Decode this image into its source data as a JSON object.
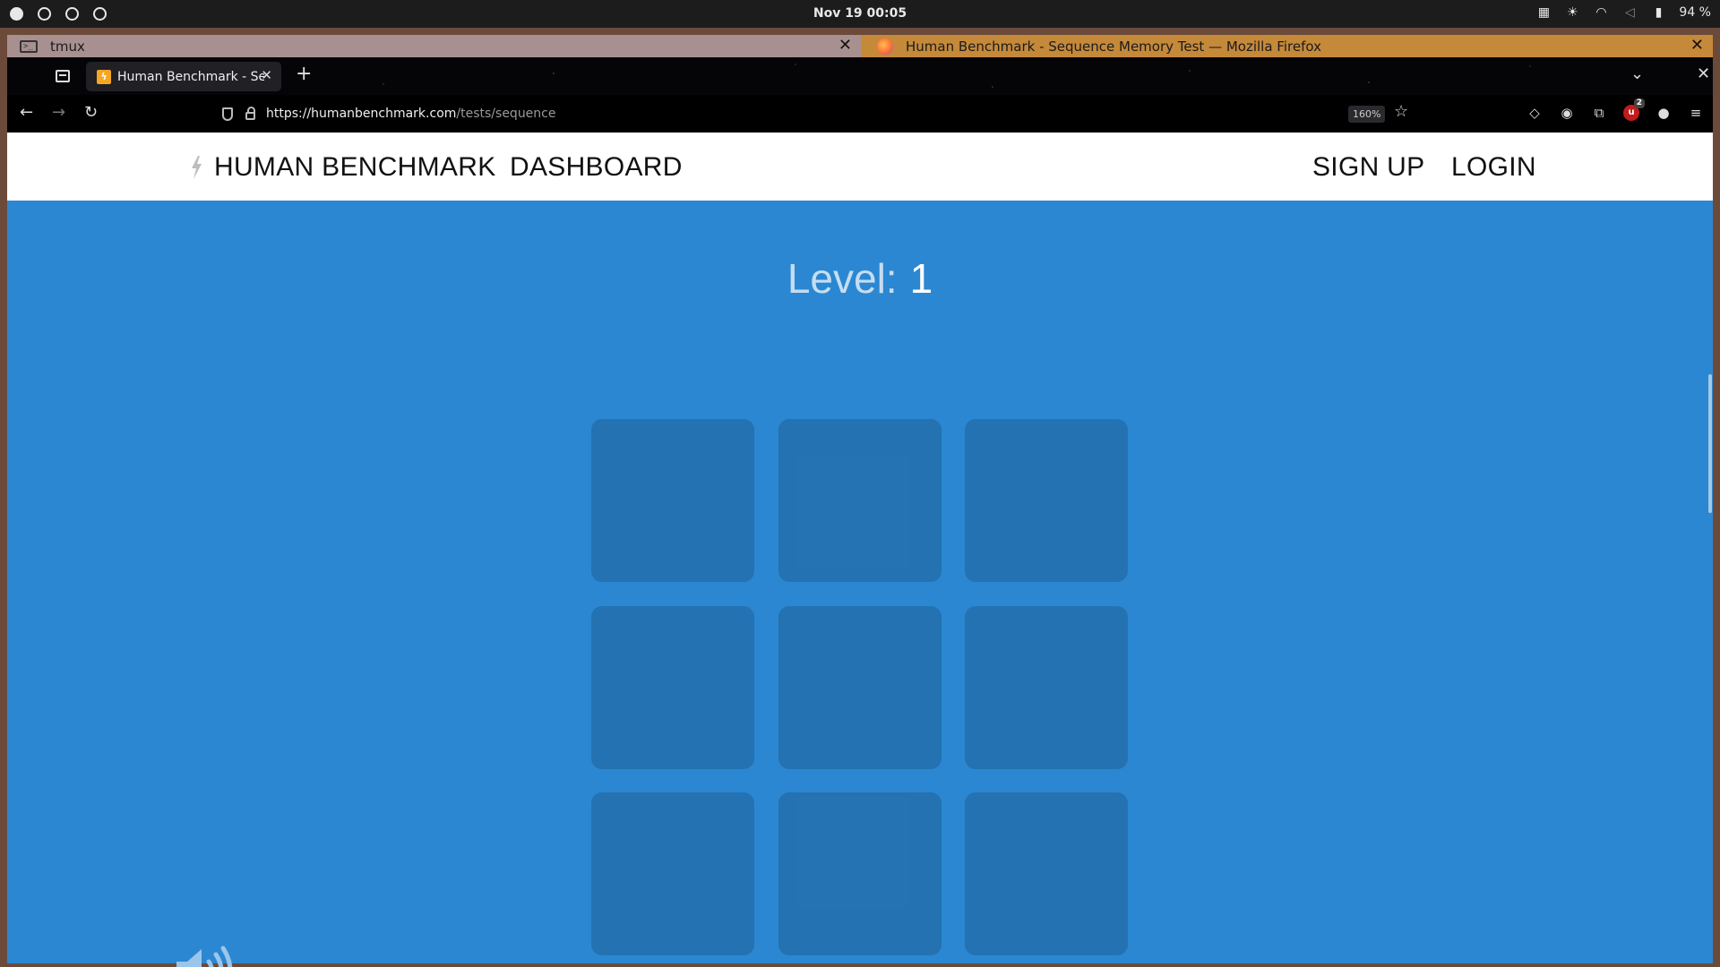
{
  "os": {
    "clock": "Nov 19  00:05",
    "battery": "94 %"
  },
  "windows": {
    "tmux_title": "tmux",
    "firefox_title": "Human Benchmark - Sequence Memory Test — Mozilla Firefox"
  },
  "browser": {
    "tab_title": "Human Benchmark - Sequence Memory Test",
    "url_host": "https://humanbenchmark.com",
    "url_path": "/tests/sequence",
    "zoom": "160%",
    "ublock_count": "2"
  },
  "site": {
    "brand": "HUMAN BENCHMARK",
    "nav_dashboard": "DASHBOARD",
    "nav_signup": "SIGN UP",
    "nav_login": "LOGIN"
  },
  "game": {
    "level_label": "Level:",
    "level_value": "1",
    "grid_rows": 3,
    "grid_cols": 3
  },
  "colors": {
    "page_bg": "#2b87d1",
    "square": "rgba(0,0,0,0.15)",
    "firefox_titlebar": "#c5893a",
    "tmux_titlebar": "#a89090"
  }
}
